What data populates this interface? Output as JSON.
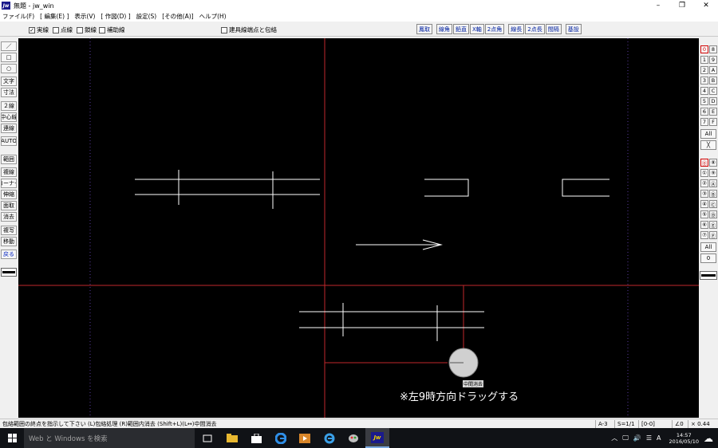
{
  "window": {
    "title": "無題 - jw_win",
    "app_icon": "Jw"
  },
  "window_controls": {
    "minimize": "–",
    "maximize": "❐",
    "close": "✕"
  },
  "menu": [
    "ファイル(F)",
    "[ 編集(E) ]",
    "表示(V)",
    "[ 作図(D) ]",
    "設定(S)",
    "[その他(A)]",
    "ヘルプ(H)"
  ],
  "options": {
    "solid": "実線",
    "dotted": "点線",
    "chain": "鎖線",
    "aux": "補助線",
    "solid_checked": "✓",
    "fitting": "建具線端点と包絡"
  },
  "snap_buttons": [
    "鳳取",
    "線角",
    "鉛直",
    "X軸",
    "2点角",
    "線長",
    "2点長",
    "間隔",
    "基設"
  ],
  "left_tools": [
    "／",
    "□",
    "○",
    "文字",
    "寸法",
    "２線",
    "中心線",
    "連線",
    "AUTO",
    "範囲",
    "複線",
    "コーナー",
    "伸縮",
    "面取",
    "消去",
    "複写",
    "移動",
    "戻る"
  ],
  "layer_groups": [
    "0",
    "8",
    "1",
    "9",
    "2",
    "A",
    "3",
    "B",
    "4",
    "C",
    "5",
    "D",
    "6",
    "E",
    "7",
    "F"
  ],
  "layers": [
    "⓪",
    "⑧",
    "①",
    "⑨",
    "②",
    "Ⓐ",
    "③",
    "Ⓑ",
    "④",
    "Ⓒ",
    "⑤",
    "Ⓓ",
    "⑥",
    "Ⓔ",
    "⑦",
    "Ⓕ"
  ],
  "right_buttons": {
    "all": "All",
    "x": "╳",
    "all2": "All",
    "zero": "0"
  },
  "canvas": {
    "caption": "※左9時方向ドラッグする",
    "tip_label": "中間消去"
  },
  "status": {
    "message": "包絡範囲の終点を指示して下さい (L)包絡処理 (R)範囲内消去 (Shift+L)(L↔)中間消去",
    "paper": "A-3",
    "scale": "S=1/1",
    "layer": "[0-0]",
    "angle": "∠0",
    "zoom": "× 0.44"
  },
  "taskbar": {
    "search_placeholder": "Web と Windows を検索",
    "ime": "A",
    "time": "14:57",
    "date": "2016/05/10"
  },
  "colors": {
    "canvas_bg": "#000000",
    "drawing_line": "#ffffff",
    "guide_red": "#c0282c",
    "grid_purple": "#5a3aa0"
  }
}
